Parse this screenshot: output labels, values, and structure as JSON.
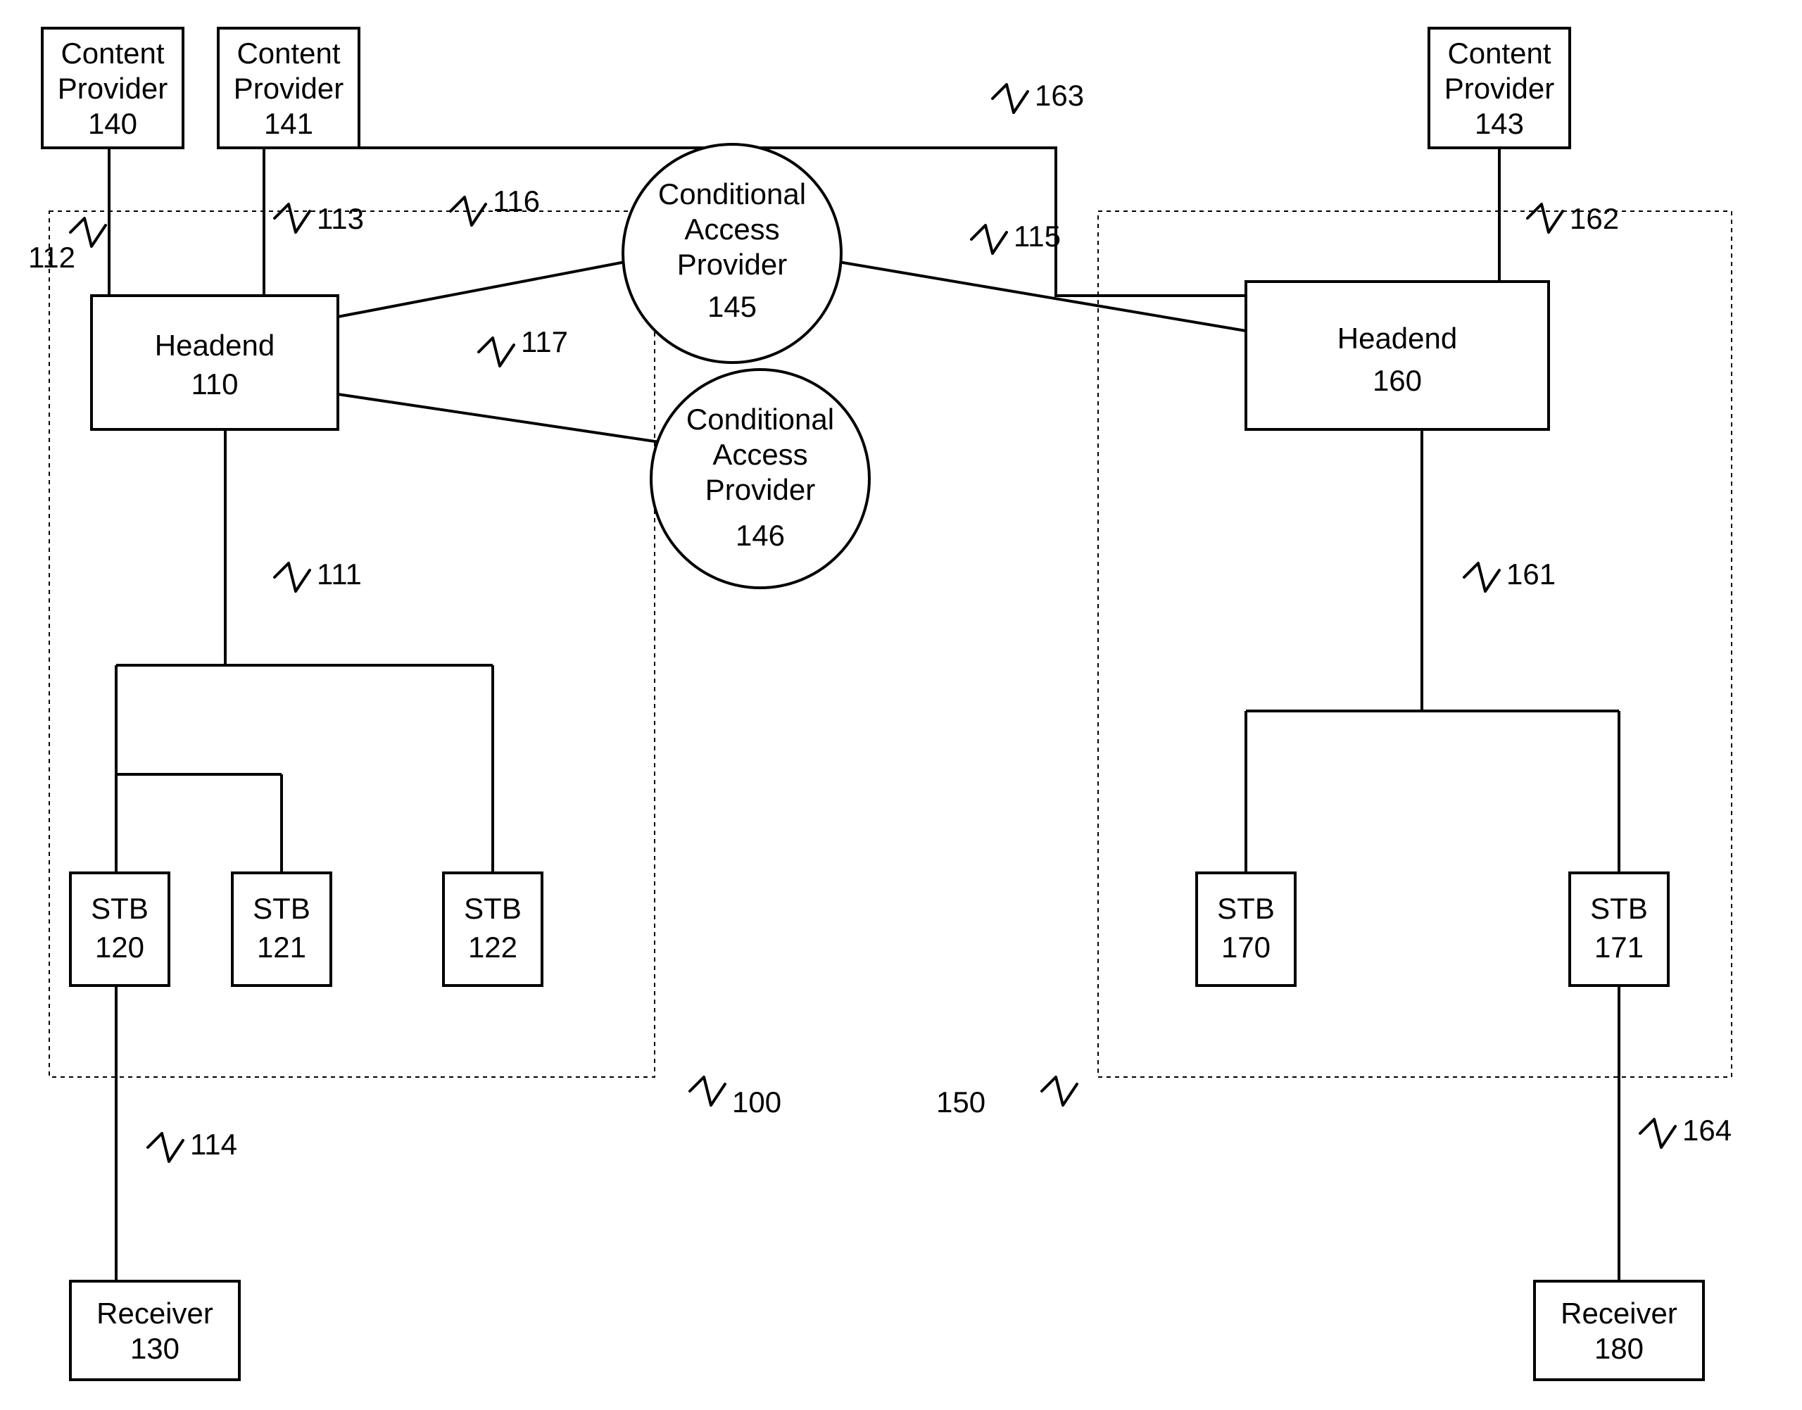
{
  "boxes": {
    "cp140": {
      "line1": "Content",
      "line2": "Provider",
      "num": "140"
    },
    "cp141": {
      "line1": "Content",
      "line2": "Provider",
      "num": "141"
    },
    "cp143": {
      "line1": "Content",
      "line2": "Provider",
      "num": "143"
    },
    "headend110": {
      "line1": "Headend",
      "num": "110"
    },
    "headend160": {
      "line1": "Headend",
      "num": "160"
    },
    "stb120": {
      "line1": "STB",
      "num": "120"
    },
    "stb121": {
      "line1": "STB",
      "num": "121"
    },
    "stb122": {
      "line1": "STB",
      "num": "122"
    },
    "stb170": {
      "line1": "STB",
      "num": "170"
    },
    "stb171": {
      "line1": "STB",
      "num": "171"
    },
    "receiver130": {
      "line1": "Receiver",
      "num": "130"
    },
    "receiver180": {
      "line1": "Receiver",
      "num": "180"
    }
  },
  "circles": {
    "cap145": {
      "line1": "Conditional",
      "line2": "Access",
      "line3": "Provider",
      "num": "145"
    },
    "cap146": {
      "line1": "Conditional",
      "line2": "Access",
      "line3": "Provider",
      "num": "146"
    }
  },
  "refs": {
    "r112": "112",
    "r113": "113",
    "r116": "116",
    "r117": "117",
    "r163": "163",
    "r115": "115",
    "r162": "162",
    "r111": "111",
    "r161": "161",
    "r114": "114",
    "r164": "164",
    "r100": "100",
    "r150": "150"
  }
}
